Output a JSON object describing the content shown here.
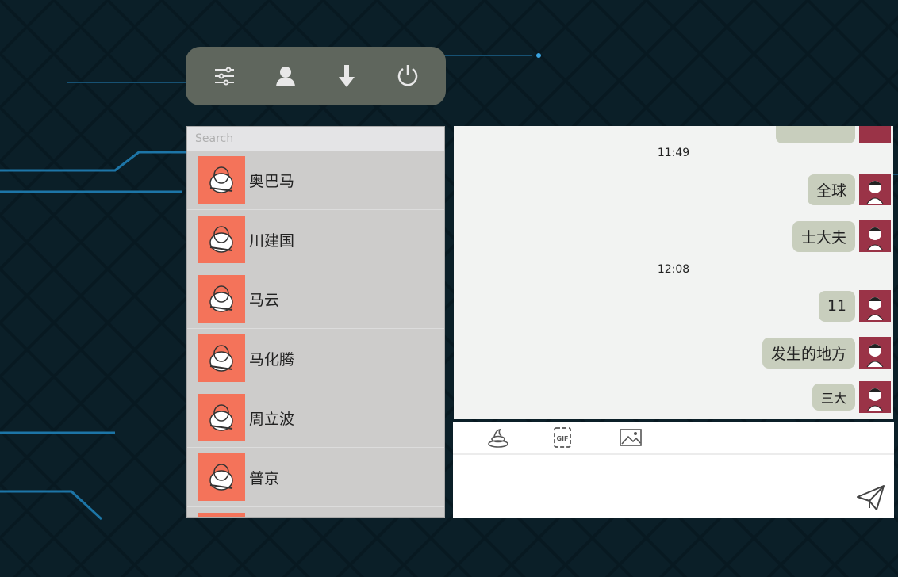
{
  "toolbar": {
    "icons": [
      "settings-sliders-icon",
      "user-icon",
      "download-icon",
      "power-icon"
    ]
  },
  "search": {
    "placeholder": "Search"
  },
  "contacts": [
    {
      "name": "奥巴马"
    },
    {
      "name": "川建国"
    },
    {
      "name": "马云"
    },
    {
      "name": "马化腾"
    },
    {
      "name": "周立波"
    },
    {
      "name": "普京"
    }
  ],
  "chat": {
    "times": [
      "11:49",
      "12:08"
    ],
    "messages": [
      "全球",
      "士大夫",
      "11",
      "发生的地方",
      "三大"
    ]
  },
  "composer": {
    "tools": [
      "emoji-poop-icon",
      "gif-icon",
      "image-icon"
    ],
    "input_value": "",
    "send_icon": "paper-plane-icon"
  },
  "colors": {
    "toolbar_bg": "#5f665d",
    "contact_avatar": "#f4735a",
    "message_avatar": "#9a3347",
    "bubble": "#c8cebd",
    "chat_bg": "#f2f3f2"
  }
}
